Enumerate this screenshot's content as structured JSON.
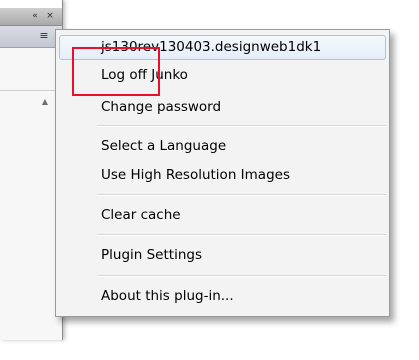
{
  "panel": {
    "collapse_icon": "«",
    "close_icon": "×",
    "menu_icon": "≡",
    "scroll_up_icon": "▲"
  },
  "menu": {
    "items": [
      {
        "label": "js130rev130403.designweb1dk1"
      },
      {
        "label": "Log off Junko"
      },
      {
        "label": "Change password"
      },
      {
        "label": "Select a Language"
      },
      {
        "label": "Use High Resolution Images"
      },
      {
        "label": "Clear cache"
      },
      {
        "label": "Plugin Settings"
      },
      {
        "label": "About this plug-in..."
      }
    ]
  },
  "colors": {
    "highlight_box": "#e8102a",
    "hover_border": "#a9c4ea",
    "menu_bg": "#f3f3f3"
  }
}
